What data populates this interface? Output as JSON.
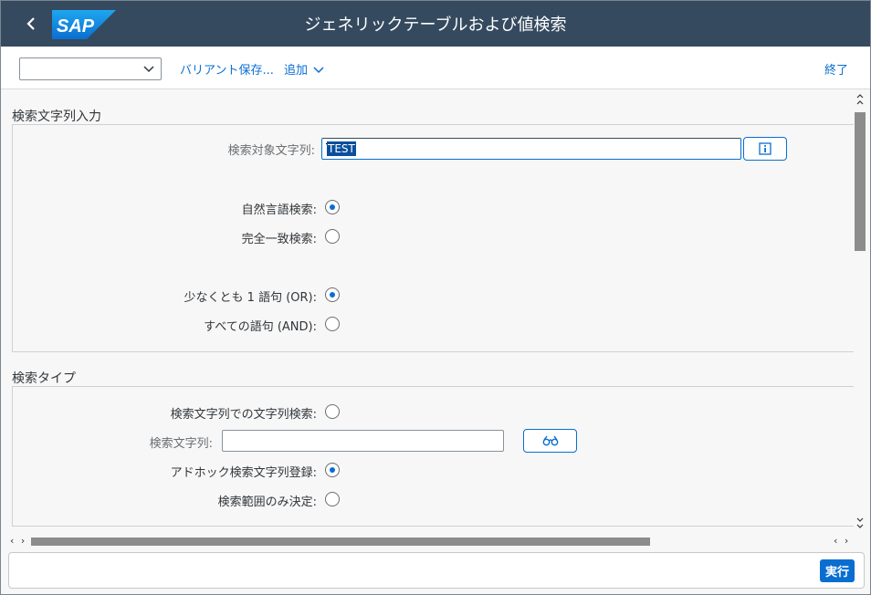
{
  "shell": {
    "title": "ジェネリックテーブルおよび値検索",
    "logo_text": "SAP",
    "brand_color": "#354a5f",
    "back_icon": "chevron-left-icon"
  },
  "toolbar": {
    "variant_value": "",
    "save_variant_label": "バリアント保存...",
    "add_label": "追加",
    "exit_label": "終了"
  },
  "search_input_section": {
    "title": "検索文字列入力",
    "search_string_label": "検索対象文字列:",
    "search_string_value": "TEST",
    "info_icon": "info-icon",
    "natural_language_label": "自然言語検索:",
    "natural_language_selected": true,
    "exact_match_label": "完全一致検索:",
    "exact_match_selected": false,
    "at_least_one_label": "少なくとも 1 語句 (OR):",
    "at_least_one_selected": true,
    "all_words_label": "すべての語句 (AND):",
    "all_words_selected": false
  },
  "search_type_section": {
    "title": "検索タイプ",
    "string_search_label": "検索文字列での文字列検索:",
    "string_search_selected": false,
    "search_string_label": "検索文字列:",
    "search_string_value": "",
    "search_help_icon": "glasses-icon",
    "adhoc_register_label": "アドホック検索文字列登録:",
    "adhoc_register_selected": true,
    "scope_only_label": "検索範囲のみ決定:",
    "scope_only_selected": false
  },
  "footer": {
    "execute_label": "実行",
    "accent_color": "#0a6ed1"
  }
}
